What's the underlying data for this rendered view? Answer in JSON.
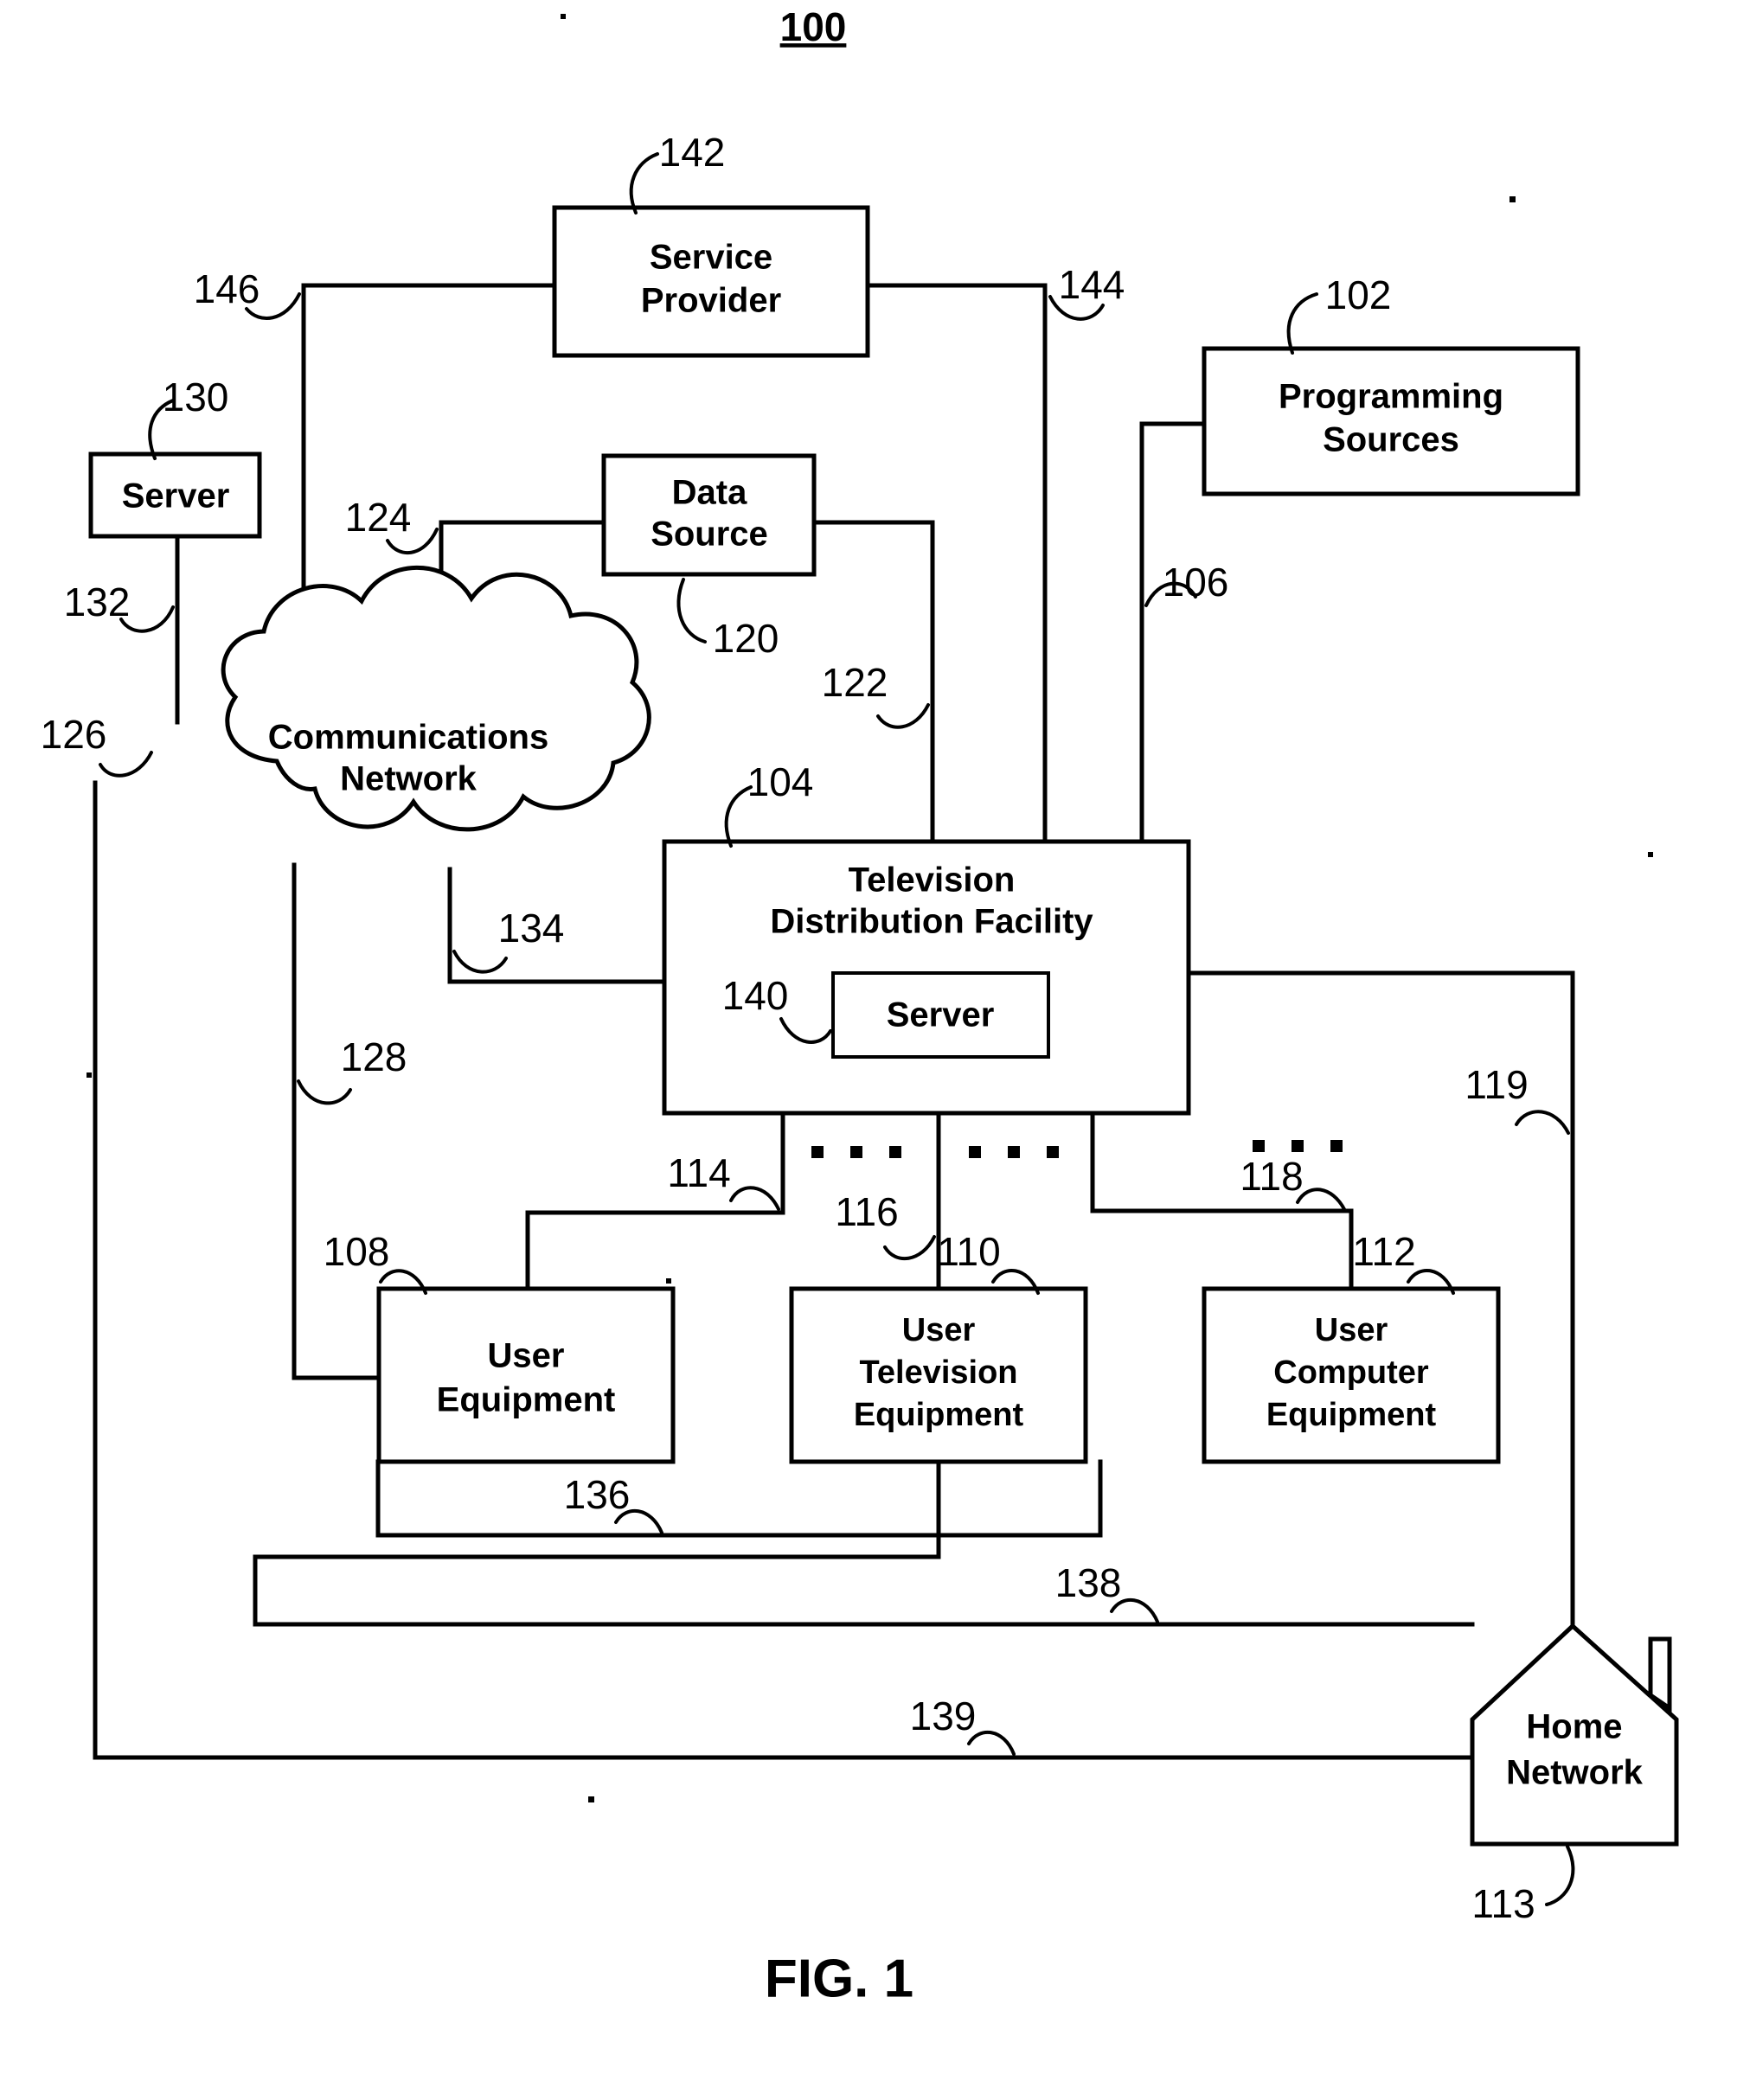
{
  "figure": {
    "figure_number": "100",
    "caption": "FIG. 1"
  },
  "nodes": {
    "service_provider": {
      "label_line1": "Service",
      "label_line2": "Provider",
      "ref": "142"
    },
    "programming_sources": {
      "label_line1": "Programming",
      "label_line2": "Sources",
      "ref": "102"
    },
    "server_left": {
      "label": "Server",
      "ref": "130"
    },
    "data_source": {
      "label_line1": "Data",
      "label_line2": "Source",
      "ref": "120"
    },
    "communications_network": {
      "label_line1": "Communications",
      "label_line2": "Network",
      "ref": "126"
    },
    "television_distribution_facility": {
      "label_line1": "Television",
      "label_line2": "Distribution Facility",
      "ref": "104"
    },
    "server_tdf": {
      "label": "Server",
      "ref": "140"
    },
    "user_equipment": {
      "label_line1": "User",
      "label_line2": "Equipment",
      "ref": "108"
    },
    "user_television_equipment": {
      "label_line1": "User",
      "label_line2": "Television",
      "label_line3": "Equipment",
      "ref": "110"
    },
    "user_computer_equipment": {
      "label_line1": "User",
      "label_line2": "Computer",
      "label_line3": "Equipment",
      "ref": "112"
    },
    "home_network": {
      "label_line1": "Home",
      "label_line2": "Network",
      "ref": "113"
    }
  },
  "connection_refs": {
    "sp_to_network": "146",
    "sp_to_tdf": "144",
    "prog_to_tdf": "106",
    "server_to_network": "132",
    "data_source_to_network": "124",
    "data_source_to_tdf": "122",
    "network_to_tdf": "134",
    "network_to_user_equipment": "128",
    "tdf_to_user_equipment": "114",
    "tdf_to_user_tv_equipment": "116",
    "tdf_to_user_computer_equipment": "118",
    "tdf_to_home_network": "119",
    "ue_to_home_network": "136",
    "utv_to_home_network": "138",
    "ucomp_to_home_network": "139"
  },
  "ref_list": [
    "100",
    "102",
    "104",
    "106",
    "108",
    "110",
    "112",
    "113",
    "114",
    "116",
    "118",
    "119",
    "120",
    "122",
    "124",
    "126",
    "128",
    "130",
    "132",
    "134",
    "136",
    "138",
    "139",
    "140",
    "142",
    "144",
    "146"
  ],
  "colors": {
    "stroke": "#000000",
    "background": "#ffffff",
    "text": "#000000"
  }
}
